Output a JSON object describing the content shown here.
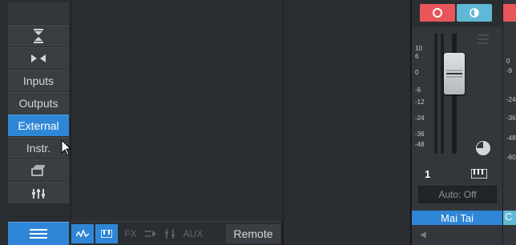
{
  "nav": {
    "items": [
      {
        "label": "",
        "icon": "collapse-vertical-icon"
      },
      {
        "label": "",
        "icon": "collapse-horizontal-icon"
      },
      {
        "label": "Inputs"
      },
      {
        "label": "Outputs"
      },
      {
        "label": "External",
        "active": true
      },
      {
        "label": "Instr."
      },
      {
        "label": "",
        "icon": "stack-icon"
      },
      {
        "label": "",
        "icon": "mixer-icon"
      },
      {
        "label": "",
        "icon": "menu-icon",
        "active": true
      }
    ]
  },
  "bottom_bar": {
    "buttons": [
      {
        "label": "",
        "icon": "waveform-icon",
        "on": true
      },
      {
        "label": "",
        "icon": "keyboard-icon",
        "on": true
      },
      {
        "label": "FX"
      },
      {
        "label": "",
        "icon": "bus-icon"
      },
      {
        "label": "",
        "icon": "sends-icon"
      },
      {
        "label": "AUX"
      }
    ],
    "remote_label": "Remote"
  },
  "channel": {
    "number": "1",
    "automation": "Auto: Off",
    "name": "Mai Tai",
    "scale": [
      "10",
      "6",
      "0",
      "-6",
      "-12",
      "-24",
      "-36",
      "-48"
    ],
    "colors": {
      "record": "#e8565a",
      "monitor": "#5fb8d6",
      "name": "#2f86d6"
    }
  },
  "next_channel": {
    "name_partial": "C",
    "scale_partial": [
      "0",
      "-9",
      "-24",
      "-36",
      "-48",
      "-60"
    ]
  }
}
